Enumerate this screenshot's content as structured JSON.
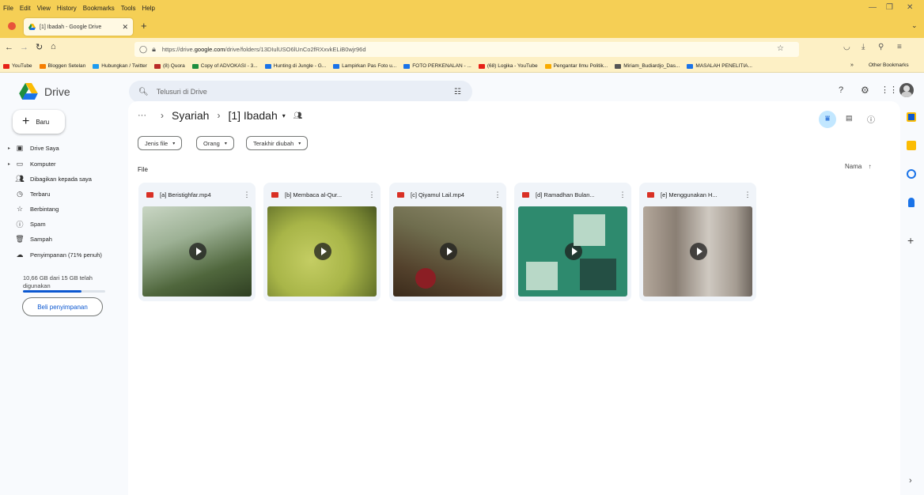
{
  "browser": {
    "menu": [
      "File",
      "Edit",
      "View",
      "History",
      "Bookmarks",
      "Tools",
      "Help"
    ],
    "tab_title": "[1] Ibadah - Google Drive",
    "url_prefix": "https://drive.",
    "url_domain": "google.com",
    "url_rest": "/drive/folders/13DIulUSO6lUnCo2fRXxvkELiB0wjr96d",
    "bookmarks": [
      {
        "label": "YouTube",
        "color": "#e62117"
      },
      {
        "label": "Bloggen Setelan",
        "color": "#f57d00"
      },
      {
        "label": "Hubungkan / Twitter",
        "color": "#1d9bf0"
      },
      {
        "label": "(8) Quora",
        "color": "#b92b27"
      },
      {
        "label": "Copy of ADVOKASI - 3...",
        "color": "#1e8e3e"
      },
      {
        "label": "Hunting di Jungle - G...",
        "color": "#1a73e8"
      },
      {
        "label": "Lampirkan Pas Foto u...",
        "color": "#1a73e8"
      },
      {
        "label": "FOTO PERKENALAN - ...",
        "color": "#1a73e8"
      },
      {
        "label": "(68) Logika - YouTube",
        "color": "#e62117"
      },
      {
        "label": "Pengantar Ilmu Politik...",
        "color": "#f9ab00"
      },
      {
        "label": "Miriam_Budiardjo_Das...",
        "color": "#555555"
      },
      {
        "label": "MASALAH PENELITIA...",
        "color": "#1a73e8"
      }
    ],
    "other_bookmarks": "Other Bookmarks"
  },
  "drive": {
    "app_name": "Drive",
    "search_placeholder": "Telusuri di Drive",
    "new_button": "Baru",
    "nav": [
      {
        "label": "Drive Saya",
        "icon": "my-drive-icon"
      },
      {
        "label": "Komputer",
        "icon": "computer-icon"
      },
      {
        "label": "Dibagikan kepada saya",
        "icon": "shared-icon"
      },
      {
        "label": "Terbaru",
        "icon": "clock-icon"
      },
      {
        "label": "Berbintang",
        "icon": "star-icon"
      },
      {
        "label": "Spam",
        "icon": "spam-icon"
      },
      {
        "label": "Sampah",
        "icon": "trash-icon"
      },
      {
        "label": "Penyimpanan (71% penuh)",
        "icon": "cloud-icon"
      }
    ],
    "storage_text": "10,66 GB dari 15 GB telah digunakan",
    "storage_fraction": 0.71,
    "buy_storage": "Beli penyimpanan",
    "breadcrumb": {
      "ellipsis": "···",
      "parent": "Syariah",
      "current": "[1] Ibadah"
    },
    "filters": [
      "Jenis file",
      "Orang",
      "Terakhir diubah"
    ],
    "section_label": "File",
    "sort_label": "Nama",
    "files": [
      {
        "name": "[a] Beristighfar.mp4"
      },
      {
        "name": "[b] Membaca al-Qur..."
      },
      {
        "name": "[c] Qiyamul Lail.mp4"
      },
      {
        "name": "[d] Ramadhan Bulan..."
      },
      {
        "name": "[e] Menggunakan H..."
      }
    ]
  }
}
